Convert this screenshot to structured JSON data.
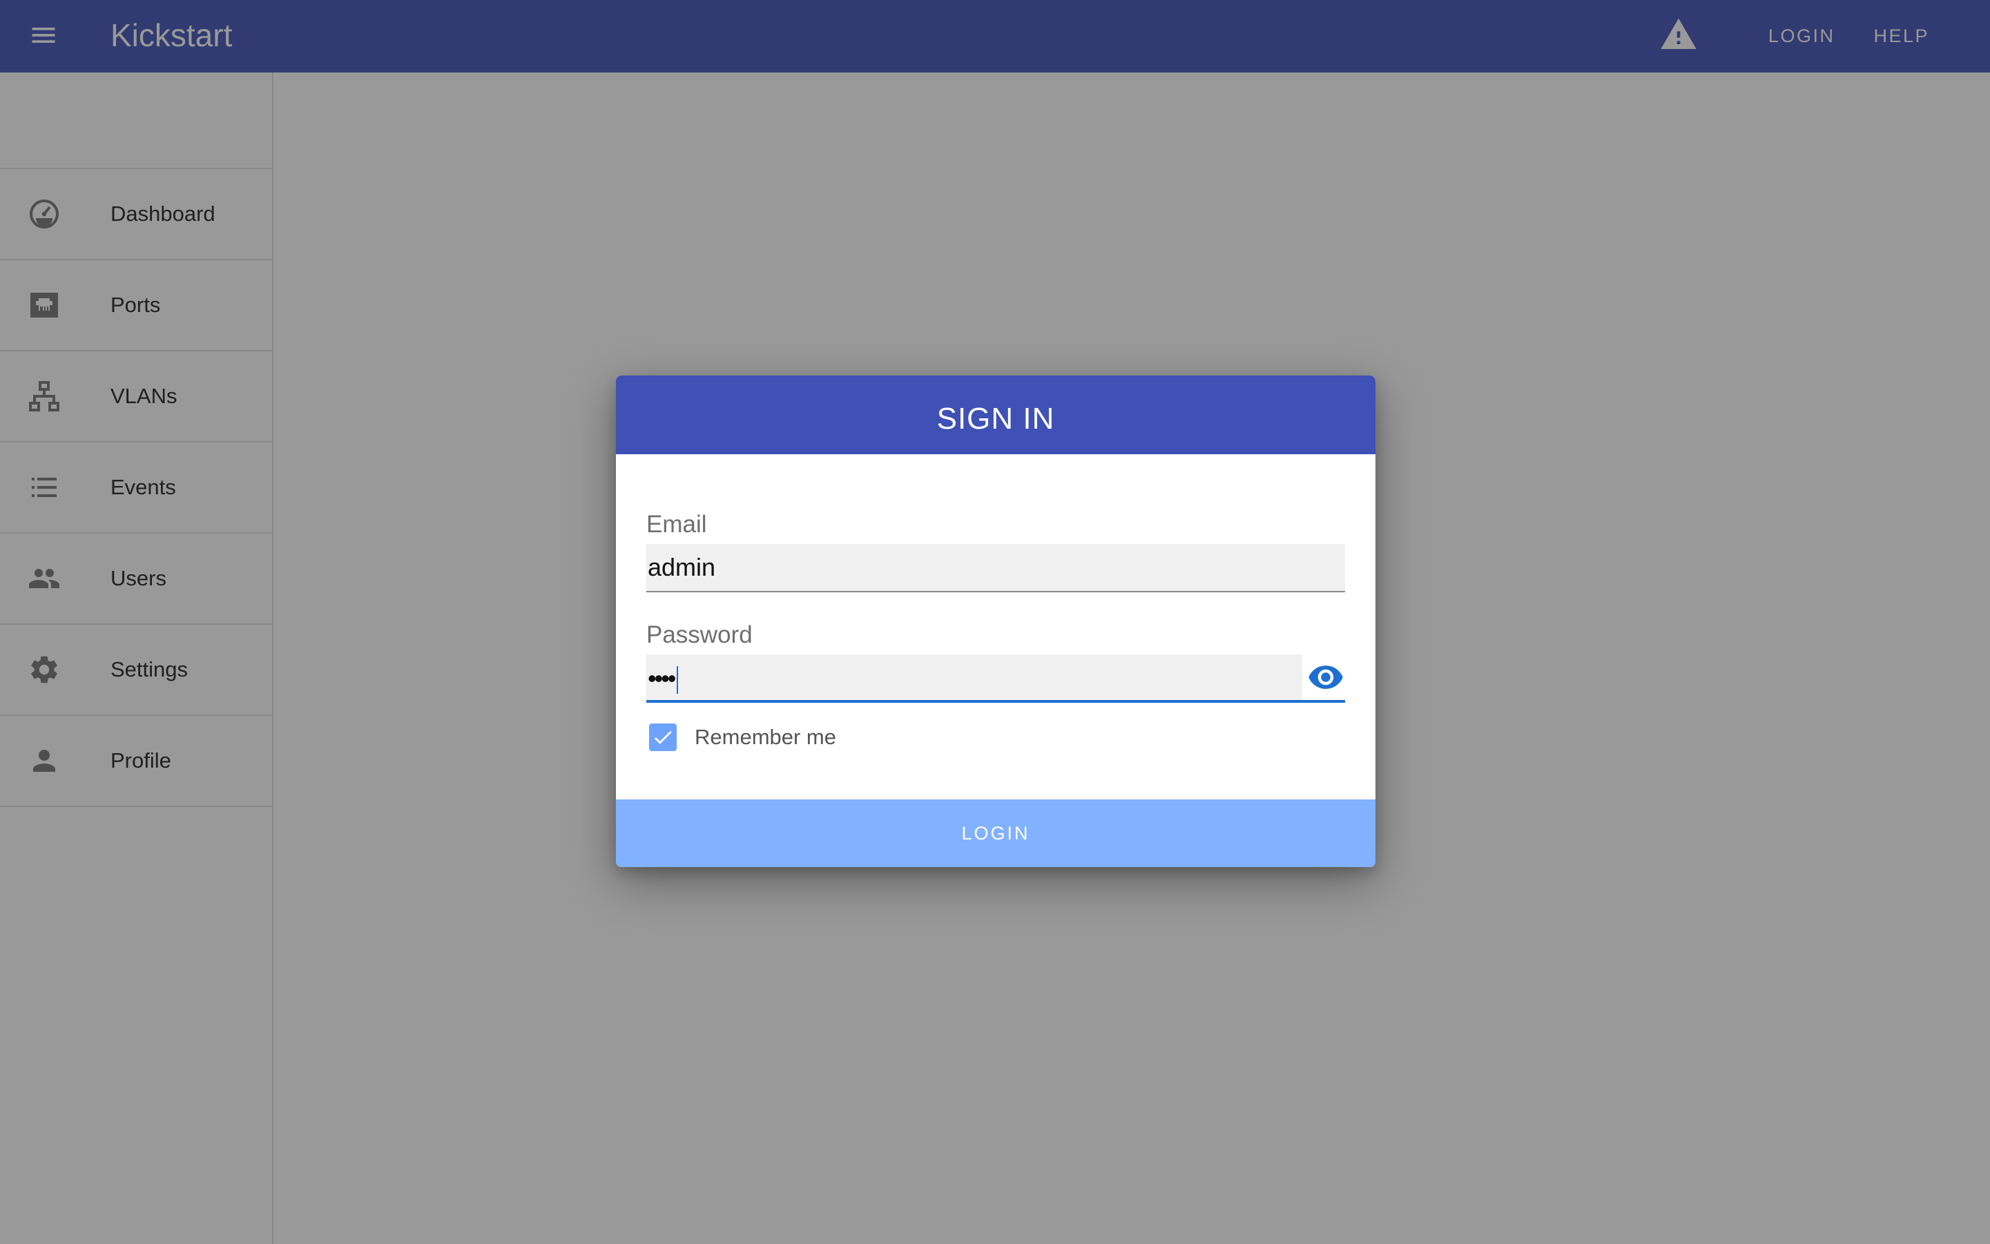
{
  "appbar": {
    "title": "Kickstart",
    "menu_icon": "hamburger-menu-icon",
    "warning_icon": "warning-triangle-icon",
    "links": {
      "login": "LOGIN",
      "help": "HELP"
    },
    "color": "#3f51b5"
  },
  "sidebar": {
    "items": [
      {
        "label": "Dashboard",
        "icon": "speedometer-icon"
      },
      {
        "label": "Ports",
        "icon": "ethernet-port-icon"
      },
      {
        "label": "VLANs",
        "icon": "network-tree-icon"
      },
      {
        "label": "Events",
        "icon": "list-icon"
      },
      {
        "label": "Users",
        "icon": "group-icon"
      },
      {
        "label": "Settings",
        "icon": "gear-icon"
      },
      {
        "label": "Profile",
        "icon": "person-icon"
      }
    ]
  },
  "dialog": {
    "title": "SIGN IN",
    "email": {
      "label": "Email",
      "value": "admin"
    },
    "password": {
      "label": "Password",
      "value": "••••",
      "toggle_icon": "eye-icon"
    },
    "remember": {
      "label": "Remember me",
      "checked": true
    },
    "submit_label": "LOGIN",
    "colors": {
      "header": "#3f51b5",
      "accent": "#1e6fd0",
      "button": "#82b1ff"
    }
  }
}
